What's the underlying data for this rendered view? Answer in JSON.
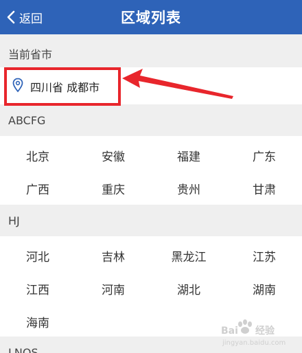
{
  "header": {
    "back_label": "返回",
    "title": "区域列表",
    "bg_color": "#2e63b8"
  },
  "current": {
    "section_label": "当前省市",
    "location": "四川省 成都市",
    "icon": "location-pin-icon"
  },
  "annotation": {
    "color": "#e8262c"
  },
  "groups": [
    {
      "label": "ABCFG",
      "cities": [
        "北京",
        "安徽",
        "福建",
        "广东",
        "广西",
        "重庆",
        "贵州",
        "甘肃"
      ]
    },
    {
      "label": "HJ",
      "cities": [
        "河北",
        "吉林",
        "黑龙江",
        "江苏",
        "江西",
        "河南",
        "湖北",
        "湖南",
        "海南"
      ]
    },
    {
      "label": "LNQS",
      "cities": []
    }
  ],
  "watermark": {
    "text": "Bai 经验",
    "sub": "jingyan.baidu.com"
  }
}
